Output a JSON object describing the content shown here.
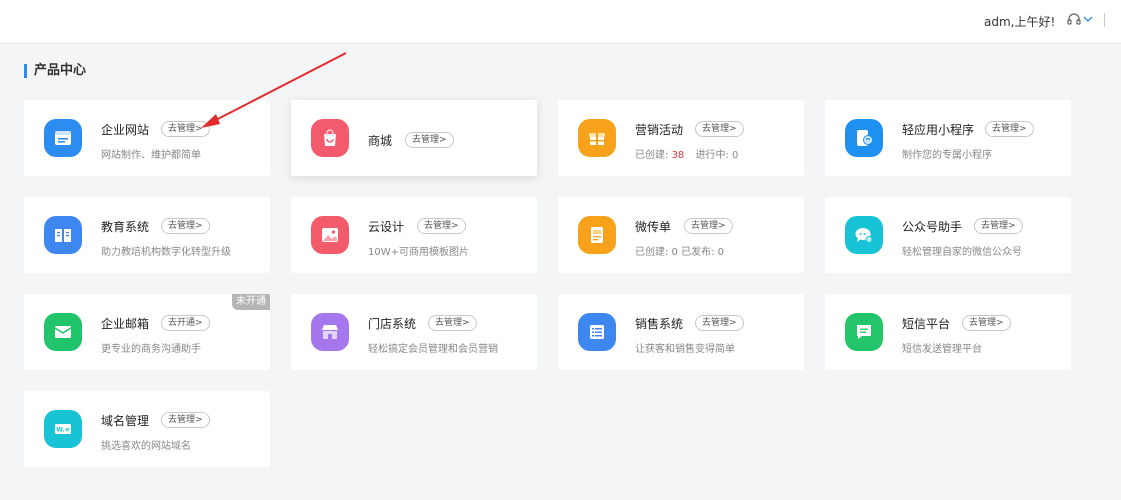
{
  "header": {
    "greeting": "adm,上午好!"
  },
  "section": {
    "title": "产品中心"
  },
  "cards": [
    {
      "name": "企业网站",
      "action": "去管理>",
      "desc": "网站制作、维护都简单",
      "icon": "browser-window-icon",
      "color": "#2d8cf0"
    },
    {
      "name": "商城",
      "action": "去管理>",
      "desc": "",
      "icon": "shopping-bag-icon",
      "color": "#f45a6d"
    },
    {
      "name": "营销活动",
      "action": "去管理>",
      "desc_prefix": "已创建:",
      "created": "38",
      "desc_mid": "进行中:",
      "running": "0",
      "icon": "gift-icon",
      "color": "#f7a21a"
    },
    {
      "name": "轻应用小程序",
      "action": "去管理>",
      "desc": "制作您的专属小程序",
      "icon": "mini-program-icon",
      "color": "#1e90ef"
    },
    {
      "name": "教育系统",
      "action": "去管理>",
      "desc": "助力教培机构数字化转型升级",
      "icon": "open-book-icon",
      "color": "#3f87f0"
    },
    {
      "name": "云设计",
      "action": "去管理>",
      "desc": "10W+可商用模板图片",
      "icon": "image-icon",
      "color": "#f35b6a"
    },
    {
      "name": "微传单",
      "action": "去管理>",
      "desc": "已创建: 0   已发布: 0",
      "icon": "flyer-icon",
      "color": "#f7a21a"
    },
    {
      "name": "公众号助手",
      "action": "去管理>",
      "desc": "轻松管理自家的微信公众号",
      "icon": "chat-gear-icon",
      "color": "#18c3d6"
    },
    {
      "name": "企业邮箱",
      "action": "去开通>",
      "desc": "更专业的商务沟通助手",
      "badge": "未开通",
      "icon": "mail-icon",
      "color": "#1fc46b"
    },
    {
      "name": "门店系统",
      "action": "去管理>",
      "desc": "轻松搞定会员管理和会员营销",
      "icon": "storefront-icon",
      "color": "#a477ee"
    },
    {
      "name": "销售系统",
      "action": "去管理>",
      "desc": "让获客和销售变得简单",
      "icon": "list-icon",
      "color": "#3f87f0"
    },
    {
      "name": "短信平台",
      "action": "去管理>",
      "desc": "短信发送管理平台",
      "icon": "message-icon",
      "color": "#24c56a"
    },
    {
      "name": "域名管理",
      "action": "去管理>",
      "desc": "挑选喜欢的网站域名",
      "icon": "domain-icon",
      "color": "#18c3d6"
    }
  ]
}
